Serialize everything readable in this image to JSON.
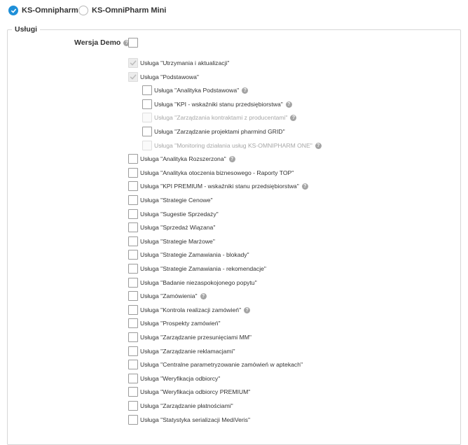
{
  "product_selector": {
    "options": [
      {
        "label": "KS-Omnipharm",
        "checked": true
      },
      {
        "label": "KS-OmniPharm Mini",
        "checked": false
      }
    ]
  },
  "services": {
    "legend": "Usługi",
    "demo_label": "Wersja Demo",
    "demo_checked": false,
    "items": [
      {
        "label": "Usługa \"Utrzymania i aktualizacji\"",
        "level": 1,
        "state": "checked-disabled",
        "help": false
      },
      {
        "label": "Usługa \"Podstawowa\"",
        "level": 1,
        "state": "checked-disabled",
        "help": false
      },
      {
        "label": "Usługa \"Analityka Podstawowa\"",
        "level": 2,
        "state": "unchecked",
        "help": true
      },
      {
        "label": "Usługa \"KPI - wskaźniki stanu przedsiębiorstwa\"",
        "level": 2,
        "state": "unchecked",
        "help": true
      },
      {
        "label": "Usługa \"Zarządzania kontraktami z producentami\"",
        "level": 2,
        "state": "disabled",
        "help": true
      },
      {
        "label": "Usługa \"Zarządzanie projektami pharmind GRID\"",
        "level": 2,
        "state": "unchecked",
        "help": false
      },
      {
        "label": "Usługa \"Monitoring działania usług KS-OMNIPHARM ONE\"",
        "level": 2,
        "state": "disabled",
        "help": true
      },
      {
        "label": "Usługa \"Analityka Rozszerzona\"",
        "level": 1,
        "state": "unchecked",
        "help": true
      },
      {
        "label": "Usługa \"Analityka otoczenia biznesowego - Raporty TOP\"",
        "level": 1,
        "state": "unchecked",
        "help": false
      },
      {
        "label": "Usługa \"KPI PREMIUM - wskaźniki stanu przedsiębiorstwa\"",
        "level": 1,
        "state": "unchecked",
        "help": true
      },
      {
        "label": "Usługa \"Strategie Cenowe\"",
        "level": 1,
        "state": "unchecked",
        "help": false
      },
      {
        "label": "Usługa \"Sugestie Sprzedaży\"",
        "level": 1,
        "state": "unchecked",
        "help": false
      },
      {
        "label": "Usługa \"Sprzedaż Wiązana\"",
        "level": 1,
        "state": "unchecked",
        "help": false
      },
      {
        "label": "Usługa \"Strategie Marżowe\"",
        "level": 1,
        "state": "unchecked",
        "help": false
      },
      {
        "label": "Usługa \"Strategie Zamawiania - blokady\"",
        "level": 1,
        "state": "unchecked",
        "help": false
      },
      {
        "label": "Usługa \"Strategie Zamawiania - rekomendacje\"",
        "level": 1,
        "state": "unchecked",
        "help": false
      },
      {
        "label": "Usługa \"Badanie niezaspokojonego popytu\"",
        "level": 1,
        "state": "unchecked",
        "help": false
      },
      {
        "label": "Usługa \"Zamówienia\"",
        "level": 1,
        "state": "unchecked",
        "help": true
      },
      {
        "label": "Usługa \"Kontrola realizacji zamówień\"",
        "level": 1,
        "state": "unchecked",
        "help": true
      },
      {
        "label": "Usługa \"Prospekty zamówień\"",
        "level": 1,
        "state": "unchecked",
        "help": false
      },
      {
        "label": "Usługa \"Zarządzanie przesunięciami MM\"",
        "level": 1,
        "state": "unchecked",
        "help": false
      },
      {
        "label": "Usługa \"Zarządzanie reklamacjami\"",
        "level": 1,
        "state": "unchecked",
        "help": false
      },
      {
        "label": "Usługa \"Centralne parametryzowanie zamówień w aptekach\"",
        "level": 1,
        "state": "unchecked",
        "help": false
      },
      {
        "label": "Usługa \"Weryfikacja odbiorcy\"",
        "level": 1,
        "state": "unchecked",
        "help": false
      },
      {
        "label": "Usługa \"Weryfikacja odbiorcy PREMIUM\"",
        "level": 1,
        "state": "unchecked",
        "help": false
      },
      {
        "label": "Usługa \"Zarządzanie płatnościami\"",
        "level": 1,
        "state": "unchecked",
        "help": false
      },
      {
        "label": "Usługa \"Statystyka serializacji MediVeris\"",
        "level": 1,
        "state": "unchecked",
        "help": false
      }
    ]
  },
  "colors": {
    "accent": "#1f8fd8",
    "checkbox_border": "#9b9b9b",
    "disabled_text": "#a6a6a6",
    "fieldset_border": "#d6d6d6"
  }
}
